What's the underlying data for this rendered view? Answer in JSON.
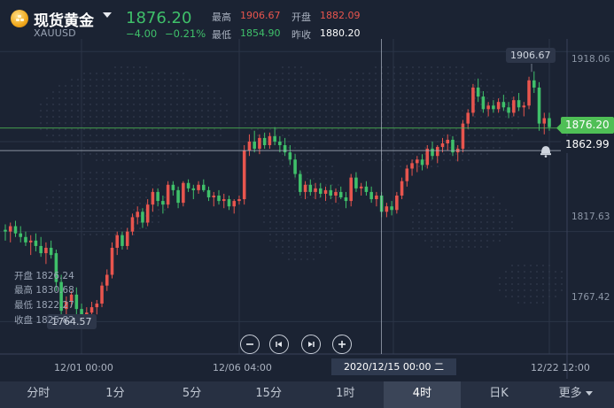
{
  "header": {
    "name": "现货黄金",
    "code": "XAUUSD",
    "last_price": "1876.20",
    "change": "−4.00",
    "change_pct": "−0.21%",
    "stats": {
      "high_label": "最高",
      "high_value": "1906.67",
      "open_label": "开盘",
      "open_value": "1882.09",
      "low_label": "最低",
      "low_value": "1854.90",
      "prev_label": "昨收",
      "prev_value": "1880.20"
    }
  },
  "chart": {
    "y_ticks": [
      "1918.06",
      "1817.63",
      "1767.42"
    ],
    "live_price_tag": "1876.20",
    "crosshair_price_tag": "1862.99",
    "max_marker": "1906.67",
    "min_marker": "1764.57",
    "cursor_time": "2020/12/15 00:00 二",
    "x_ticks": [
      "12/01 00:00",
      "12/06 04:00",
      "12/22 12:00"
    ],
    "ohlc_tooltip": [
      {
        "label": "开盘",
        "value": "1826.24"
      },
      {
        "label": "最高",
        "value": "1830.68"
      },
      {
        "label": "最低",
        "value": "1822.27"
      },
      {
        "label": "收盘",
        "value": "1825.82"
      }
    ],
    "colors": {
      "up": "#e8554e",
      "down": "#3fc06a",
      "live": "#4fbf56"
    }
  },
  "controls": {
    "zoom_out": "minus-icon",
    "prev": "skip-back-icon",
    "next": "skip-forward-icon",
    "zoom_in": "plus-icon"
  },
  "tabs": [
    "分时",
    "1分",
    "5分",
    "15分",
    "1时",
    "4时",
    "日K",
    "更多"
  ],
  "active_tab": "4时",
  "chart_data": {
    "type": "candlestick",
    "yrange": [
      1750,
      1925
    ],
    "candles": [
      [
        1819,
        1822,
        1813,
        1818
      ],
      [
        1818,
        1823,
        1812,
        1821
      ],
      [
        1821,
        1824,
        1815,
        1817
      ],
      [
        1817,
        1821,
        1812,
        1815
      ],
      [
        1815,
        1818,
        1810,
        1812
      ],
      [
        1812,
        1816,
        1805,
        1813
      ],
      [
        1813,
        1817,
        1807,
        1810
      ],
      [
        1810,
        1815,
        1804,
        1806
      ],
      [
        1806,
        1812,
        1800,
        1809
      ],
      [
        1809,
        1813,
        1803,
        1805
      ],
      [
        1806,
        1808,
        1785,
        1790
      ],
      [
        1790,
        1794,
        1770,
        1774
      ],
      [
        1775,
        1782,
        1768,
        1779
      ],
      [
        1779,
        1785,
        1776,
        1783
      ],
      [
        1783,
        1787,
        1772,
        1775
      ],
      [
        1775,
        1778,
        1764,
        1768
      ],
      [
        1768,
        1776,
        1766,
        1773
      ],
      [
        1773,
        1779,
        1770,
        1776
      ],
      [
        1776,
        1780,
        1772,
        1778
      ],
      [
        1778,
        1790,
        1776,
        1788
      ],
      [
        1788,
        1797,
        1785,
        1794
      ],
      [
        1794,
        1812,
        1792,
        1809
      ],
      [
        1809,
        1818,
        1805,
        1816
      ],
      [
        1816,
        1818,
        1808,
        1810
      ],
      [
        1810,
        1820,
        1808,
        1818
      ],
      [
        1818,
        1828,
        1816,
        1826
      ],
      [
        1826,
        1832,
        1822,
        1829
      ],
      [
        1829,
        1831,
        1820,
        1823
      ],
      [
        1823,
        1836,
        1821,
        1833
      ],
      [
        1833,
        1842,
        1829,
        1840
      ],
      [
        1840,
        1842,
        1832,
        1835
      ],
      [
        1835,
        1838,
        1828,
        1833
      ],
      [
        1833,
        1846,
        1831,
        1844
      ],
      [
        1844,
        1846,
        1838,
        1841
      ],
      [
        1841,
        1843,
        1831,
        1834
      ],
      [
        1834,
        1846,
        1832,
        1845
      ],
      [
        1845,
        1847,
        1840,
        1842
      ],
      [
        1842,
        1844,
        1836,
        1841
      ],
      [
        1841,
        1846,
        1839,
        1844
      ],
      [
        1844,
        1847,
        1840,
        1841
      ],
      [
        1841,
        1843,
        1835,
        1837
      ],
      [
        1837,
        1840,
        1832,
        1838
      ],
      [
        1838,
        1841,
        1833,
        1835
      ],
      [
        1835,
        1839,
        1831,
        1836
      ],
      [
        1836,
        1838,
        1830,
        1832
      ],
      [
        1832,
        1836,
        1828,
        1835
      ],
      [
        1835,
        1838,
        1833,
        1836
      ],
      [
        1836,
        1866,
        1833,
        1863
      ],
      [
        1863,
        1872,
        1860,
        1868
      ],
      [
        1868,
        1874,
        1862,
        1864
      ],
      [
        1864,
        1872,
        1861,
        1870
      ],
      [
        1870,
        1873,
        1864,
        1866
      ],
      [
        1866,
        1873,
        1864,
        1871
      ],
      [
        1871,
        1876,
        1866,
        1868
      ],
      [
        1868,
        1871,
        1862,
        1866
      ],
      [
        1866,
        1870,
        1860,
        1862
      ],
      [
        1862,
        1866,
        1855,
        1858
      ],
      [
        1858,
        1861,
        1848,
        1850
      ],
      [
        1850,
        1852,
        1838,
        1840
      ],
      [
        1840,
        1846,
        1836,
        1844
      ],
      [
        1844,
        1847,
        1838,
        1840
      ],
      [
        1840,
        1845,
        1836,
        1842
      ],
      [
        1842,
        1845,
        1837,
        1839
      ],
      [
        1839,
        1843,
        1835,
        1841
      ],
      [
        1841,
        1844,
        1836,
        1838
      ],
      [
        1838,
        1842,
        1834,
        1840
      ],
      [
        1840,
        1843,
        1836,
        1837
      ],
      [
        1837,
        1840,
        1831,
        1835
      ],
      [
        1835,
        1850,
        1832,
        1848
      ],
      [
        1848,
        1851,
        1840,
        1842
      ],
      [
        1842,
        1845,
        1838,
        1843
      ],
      [
        1843,
        1846,
        1838,
        1840
      ],
      [
        1840,
        1843,
        1834,
        1836
      ],
      [
        1836,
        1840,
        1832,
        1838
      ],
      [
        1838,
        1840,
        1826,
        1829
      ],
      [
        1829,
        1834,
        1826,
        1832
      ],
      [
        1832,
        1835,
        1827,
        1830
      ],
      [
        1830,
        1840,
        1828,
        1838
      ],
      [
        1838,
        1848,
        1836,
        1846
      ],
      [
        1846,
        1855,
        1843,
        1853
      ],
      [
        1853,
        1858,
        1849,
        1856
      ],
      [
        1856,
        1860,
        1851,
        1858
      ],
      [
        1858,
        1861,
        1852,
        1855
      ],
      [
        1855,
        1866,
        1853,
        1864
      ],
      [
        1864,
        1868,
        1858,
        1860
      ],
      [
        1860,
        1866,
        1856,
        1865
      ],
      [
        1865,
        1870,
        1862,
        1867
      ],
      [
        1867,
        1872,
        1863,
        1869
      ],
      [
        1869,
        1871,
        1860,
        1862
      ],
      [
        1862,
        1866,
        1857,
        1864
      ],
      [
        1864,
        1880,
        1862,
        1878
      ],
      [
        1878,
        1886,
        1875,
        1884
      ],
      [
        1884,
        1900,
        1882,
        1898
      ],
      [
        1898,
        1903,
        1890,
        1893
      ],
      [
        1893,
        1896,
        1884,
        1886
      ],
      [
        1886,
        1890,
        1882,
        1888
      ],
      [
        1888,
        1891,
        1884,
        1886
      ],
      [
        1886,
        1892,
        1884,
        1890
      ],
      [
        1890,
        1894,
        1885,
        1887
      ],
      [
        1887,
        1890,
        1881,
        1884
      ],
      [
        1884,
        1893,
        1882,
        1891
      ],
      [
        1891,
        1895,
        1885,
        1887
      ],
      [
        1887,
        1890,
        1882,
        1888
      ],
      [
        1888,
        1904,
        1886,
        1902
      ],
      [
        1902,
        1907,
        1895,
        1898
      ],
      [
        1898,
        1901,
        1874,
        1878
      ],
      [
        1878,
        1884,
        1872,
        1881
      ],
      [
        1881,
        1884,
        1874,
        1876
      ]
    ]
  }
}
